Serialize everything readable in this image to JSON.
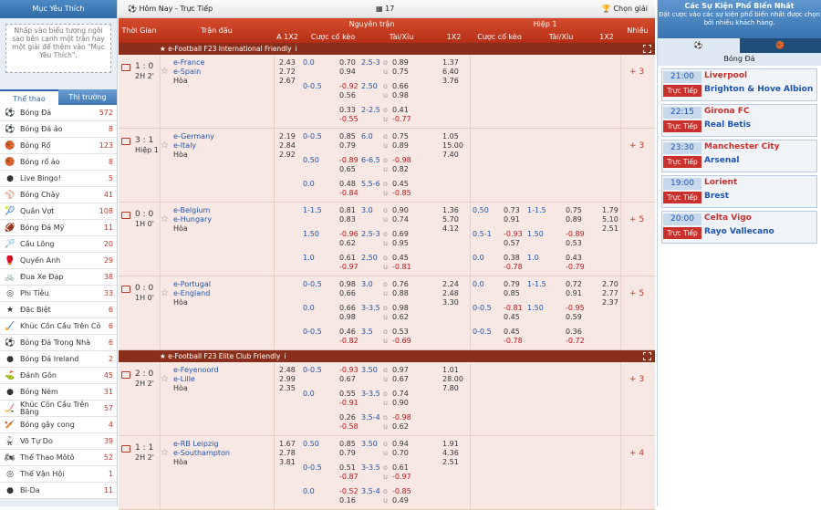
{
  "left": {
    "title": "Mục Yêu Thích",
    "fav_note": "Nhấp vào biểu tượng ngôi sao bên cạnh một trận hay một giải để thêm vào \"Mục Yêu Thích\".",
    "tab_sports": "Thể thao",
    "tab_market": "Thị trường",
    "sports": [
      {
        "name": "Bóng Đá",
        "count": "572",
        "icon": "⚽"
      },
      {
        "name": "Bóng Đá ảo",
        "count": "8",
        "icon": "⚽"
      },
      {
        "name": "Bóng Rổ",
        "count": "123",
        "icon": "🏀"
      },
      {
        "name": "Bóng rổ ảo",
        "count": "8",
        "icon": "🏀"
      },
      {
        "name": "Live Bingo!",
        "count": "5",
        "icon": "●"
      },
      {
        "name": "Bóng Chày",
        "count": "41",
        "icon": "⚾"
      },
      {
        "name": "Quần Vợt",
        "count": "108",
        "icon": "🎾"
      },
      {
        "name": "Bóng Đá Mỹ",
        "count": "11",
        "icon": "🏈"
      },
      {
        "name": "Cầu Lông",
        "count": "20",
        "icon": "🏸"
      },
      {
        "name": "Quyền Anh",
        "count": "29",
        "icon": "🥊"
      },
      {
        "name": "Đua Xe Đạp",
        "count": "38",
        "icon": "🚲"
      },
      {
        "name": "Phi Tiêu",
        "count": "33",
        "icon": "◎"
      },
      {
        "name": "Đặc Biệt",
        "count": "6",
        "icon": "★"
      },
      {
        "name": "Khúc Côn Cầu Trên Cỏ",
        "count": "6",
        "icon": "🏑"
      },
      {
        "name": "Bóng Đá Trong Nhà",
        "count": "6",
        "icon": "⚽"
      },
      {
        "name": "Bóng Đá Ireland",
        "count": "2",
        "icon": "●"
      },
      {
        "name": "Đánh Gôn",
        "count": "45",
        "icon": "⛳"
      },
      {
        "name": "Bóng Ném",
        "count": "31",
        "icon": "●"
      },
      {
        "name": "Khúc Côn Cầu Trên Băng",
        "count": "57",
        "icon": "🏒"
      },
      {
        "name": "Bóng gậy cong",
        "count": "4",
        "icon": "🏏"
      },
      {
        "name": "Võ Tự Do",
        "count": "39",
        "icon": "🥋"
      },
      {
        "name": "Thể Thao Môtô",
        "count": "52",
        "icon": "🏍"
      },
      {
        "name": "Thế Vận Hội",
        "count": "1",
        "icon": "◎"
      },
      {
        "name": "Bi-Da",
        "count": "11",
        "icon": "●"
      }
    ]
  },
  "topbar": {
    "live": "Hôm Nay - Trực Tiếp",
    "count": "17",
    "choose": "Chọn giải"
  },
  "header": {
    "time": "Thời Gian",
    "match": "Trận đấu",
    "full": "Nguyên trận",
    "a1x2": "A 1X2",
    "hdp": "Cược cố kèo",
    "ou": "Tài/Xỉu",
    "x12": "1X2",
    "half": "Hiệp 1",
    "hdp2": "Cược cố kèo",
    "ou2": "Tài/Xỉu",
    "x122": "1X2",
    "more": "Nhiều"
  },
  "leagues": [
    {
      "name": "e-Football F23 International Friendly",
      "badge": "i"
    },
    {
      "name": "e-Football F23 Elite Club Friendly",
      "badge": "i"
    }
  ],
  "matches": [
    {
      "score": "1 : 0",
      "period": "2H 2'",
      "home": "e-France",
      "away": "e-Spain",
      "draw": "Hòa",
      "a": [
        "2.43",
        "2.72",
        "2.67"
      ],
      "more": "+ 3",
      "lines": [
        [
          "0.0",
          "0.70",
          "0.94",
          "2.5-3",
          "0.89",
          "0.75",
          "1.37",
          "6.40",
          "3.76",
          "",
          "",
          "",
          "",
          "",
          "",
          "",
          ""
        ],
        [
          "0-0.5",
          "-0.92",
          "0.56",
          "2.50",
          "0.66",
          "0.98",
          "",
          "",
          "",
          "",
          "",
          "",
          "",
          "",
          "",
          "",
          ""
        ],
        [
          "",
          "0.33",
          "-0.55",
          "2-2.5",
          "0.41",
          "-0.77",
          "",
          "",
          "",
          "",
          "",
          "",
          "",
          "",
          "",
          "",
          ""
        ]
      ]
    },
    {
      "score": "3 : 1",
      "period": "Hiệp 1",
      "home": "e-Germany",
      "away": "e-Italy",
      "draw": "Hòa",
      "a": [
        "2.19",
        "2.84",
        "2.92"
      ],
      "more": "+ 3",
      "lines": [
        [
          "0-0.5",
          "0.85",
          "0.79",
          "6.0",
          "0.75",
          "0.89",
          "1.05",
          "15.00",
          "7.40",
          "",
          "",
          "",
          "",
          "",
          "",
          "",
          ""
        ],
        [
          "0.50",
          "-0.89",
          "0.65",
          "6-6.5",
          "-0.98",
          "0.82",
          "",
          "",
          "",
          "",
          "",
          "",
          "",
          "",
          "",
          "",
          ""
        ],
        [
          "0.0",
          "0.48",
          "-0.84",
          "5.5-6",
          "0.45",
          "-0.85",
          "",
          "",
          "",
          "",
          "",
          "",
          "",
          "",
          "",
          "",
          ""
        ]
      ]
    },
    {
      "score": "0 : 0",
      "period": "1H 0'",
      "home": "e-Belgium",
      "away": "e-Hungary",
      "draw": "Hòa",
      "a": [
        "",
        "",
        ""
      ],
      "more": "+ 5",
      "lines": [
        [
          "1-1.5",
          "0.81",
          "0.83",
          "3.0",
          "0.90",
          "0.74",
          "1.36",
          "5.70",
          "4.12",
          "0.50",
          "0.73",
          "0.91",
          "1-1.5",
          "0.75",
          "0.89",
          "1.79",
          "5.10",
          "2.51"
        ],
        [
          "1.50",
          "-0.96",
          "0.62",
          "2.5-3",
          "0.69",
          "0.95",
          "",
          "",
          "",
          "0.5-1",
          "-0.93",
          "0.57",
          "1.50",
          "-0.89",
          "0.53",
          ""
        ],
        [
          "1.0",
          "0.61",
          "-0.97",
          "2.50",
          "0.45",
          "-0.81",
          "",
          "",
          "",
          "0.0",
          "0.38",
          "-0.78",
          "1.0",
          "0.43",
          "-0.79",
          ""
        ]
      ]
    },
    {
      "score": "0 : 0",
      "period": "1H 0'",
      "home": "e-Portugal",
      "away": "e-England",
      "draw": "Hòa",
      "a": [
        "",
        "",
        ""
      ],
      "more": "+ 5",
      "lines": [
        [
          "0-0.5",
          "0.98",
          "0.66",
          "3.0",
          "0.76",
          "0.88",
          "2.24",
          "2.48",
          "3.30",
          "0.0",
          "0.79",
          "0.85",
          "1-1.5",
          "0.72",
          "0.91",
          "2.70",
          "2.77",
          "2.37"
        ],
        [
          "0.0",
          "0.66",
          "0.98",
          "3-3.5",
          "0.98",
          "0.62",
          "",
          "",
          "",
          "0-0.5",
          "-0.81",
          "0.45",
          "1.50",
          "-0.95",
          "0.59",
          ""
        ],
        [
          "0-0.5",
          "0.46",
          "-0.82",
          "3.5",
          "0.53",
          "-0.69",
          "",
          "",
          "",
          "0-0.5",
          "0.45",
          "-0.78",
          "",
          "0.36",
          "-0.72",
          ""
        ]
      ]
    },
    {
      "score": "2 : 0",
      "period": "2H 2'",
      "home": "e-Feyenoord",
      "away": "e-Lille",
      "draw": "Hòa",
      "a": [
        "2.48",
        "2.99",
        "2.35"
      ],
      "more": "+ 3",
      "lines": [
        [
          "0-0.5",
          "-0.93",
          "0.67",
          "3.50",
          "0.97",
          "0.67",
          "1.01",
          "28.00",
          "7.80",
          "",
          "",
          "",
          "",
          "",
          "",
          "",
          ""
        ],
        [
          "0.0",
          "0.55",
          "-0.91",
          "3-3.5",
          "0.74",
          "0.90",
          "",
          "",
          "",
          "",
          "",
          "",
          "",
          "",
          "",
          "",
          ""
        ],
        [
          "",
          "0.26",
          "-0.58",
          "3.5-4",
          "-0.98",
          "0.62",
          "",
          "",
          "",
          "",
          "",
          "",
          "",
          "",
          "",
          "",
          ""
        ]
      ]
    },
    {
      "score": "1 : 1",
      "period": "2H 2'",
      "home": "e-RB Leipzig",
      "away": "e-Southampton",
      "draw": "Hòa",
      "a": [
        "1.67",
        "2.78",
        "3.81"
      ],
      "more": "+ 4",
      "lines": [
        [
          "0.50",
          "0.85",
          "0.79",
          "3.50",
          "0.94",
          "0.70",
          "1.91",
          "4.36",
          "2.51",
          "",
          "",
          "",
          "",
          "",
          "",
          "",
          ""
        ],
        [
          "0-0.5",
          "0.51",
          "-0.87",
          "3-3.5",
          "0.61",
          "-0.97",
          "",
          "",
          "",
          "",
          "",
          "",
          "",
          "",
          "",
          "",
          ""
        ],
        [
          "0.0",
          "-0.52",
          "0.16",
          "3.5-4",
          "-0.85",
          "0.49",
          "",
          "",
          "",
          "",
          "",
          "",
          "",
          "",
          "",
          "",
          ""
        ]
      ]
    }
  ],
  "right": {
    "title": "Các Sự Kiện Phổ Biến Nhất",
    "subtitle": "Đặt cược vào các sự kiện phổ biến nhất được chọn bởi nhiều khách hàng.",
    "sport": "Bóng Đá",
    "live": "Trực Tiếp",
    "events": [
      {
        "time": "21:00",
        "home": "Liverpool",
        "away": "Brighton & Hove Albion"
      },
      {
        "time": "22:15",
        "home": "Girona FC",
        "away": "Real Betis"
      },
      {
        "time": "23:30",
        "home": "Manchester City",
        "away": "Arsenal"
      },
      {
        "time": "19:00",
        "home": "Lorient",
        "away": "Brest"
      },
      {
        "time": "20:00",
        "home": "Celta Vigo",
        "away": "Rayo Vallecano"
      }
    ]
  }
}
